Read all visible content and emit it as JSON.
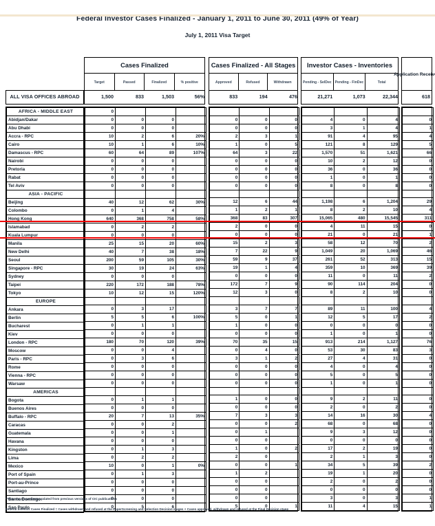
{
  "document": {
    "title": "Federal Investor Cases Finalized - January 1, 2011 to June 30, 2011 (49% of Year)",
    "subtitle": "July 1, 2011 Visa Target",
    "footnote_1": "**Data may have been updated from previous versions of CIC publications",
    "footnote_2": "Federal Investor Cases Finalized = Cases withdrawn and refused at the PaperScreening and Selection Decision stages + Cases approved, withdrawn and refused at the Final Decision stage",
    "highlight_color": "#ee0000"
  },
  "column_groups": [
    {
      "name": "cases-finalized",
      "label": "Cases Finalized",
      "columns": [
        "Target",
        "Passed",
        "Finalized",
        "% positive"
      ]
    },
    {
      "name": "cases-finalized-all-stages",
      "label": "Cases Finalized - All Stages",
      "columns": [
        "Approved",
        "Refused",
        "Withdrawn"
      ]
    },
    {
      "name": "investor-cases-inventories",
      "label": "Investor Cases - Inventories",
      "columns": [
        "Pending - SelDec",
        "Pending - FinDec",
        "Total"
      ]
    },
    {
      "name": "application-received",
      "label": "Application Received",
      "columns": []
    }
  ],
  "total_row": {
    "label": "ALL VISA OFFICES ABROAD",
    "target": "1,500",
    "passed": "833",
    "finalized": "1,503",
    "pct_positive": "56%",
    "approved": "833",
    "refused": "194",
    "withdrawn": "476",
    "pending_seldec": "21,271",
    "pending_findec": "1,073",
    "total": "22,344",
    "application_received": "618"
  },
  "rows": [
    {
      "type": "region",
      "label": "AFRICA - MIDDLE EAST",
      "target": "0",
      "passed": "",
      "finalized": "",
      "pct_positive": "",
      "approved": "",
      "refused": "",
      "withdrawn": "",
      "pending_seldec": "",
      "pending_findec": "",
      "total": "",
      "application_received": ""
    },
    {
      "type": "office",
      "label": "Abidjan/Dakar",
      "target": "0",
      "passed": "0",
      "finalized": "0",
      "pct_positive": "",
      "approved": "0",
      "refused": "0",
      "withdrawn": "0",
      "pending_seldec": "4",
      "pending_findec": "0",
      "total": "4",
      "application_received": "0"
    },
    {
      "type": "office",
      "label": "Abu Dhabi",
      "target": "0",
      "passed": "0",
      "finalized": "0",
      "pct_positive": "",
      "approved": "0",
      "refused": "0",
      "withdrawn": "0",
      "pending_seldec": "3",
      "pending_findec": "1",
      "total": "4",
      "application_received": "1"
    },
    {
      "type": "office",
      "label": "Accra - RPC",
      "target": "10",
      "passed": "2",
      "finalized": "6",
      "pct_positive": "20%",
      "approved": "2",
      "refused": "3",
      "withdrawn": "1",
      "pending_seldec": "91",
      "pending_findec": "4",
      "total": "95",
      "application_received": "4"
    },
    {
      "type": "office",
      "label": "Cairo",
      "target": "10",
      "passed": "1",
      "finalized": "6",
      "pct_positive": "10%",
      "approved": "1",
      "refused": "0",
      "withdrawn": "5",
      "pending_seldec": "121",
      "pending_findec": "8",
      "total": "129",
      "application_received": "5"
    },
    {
      "type": "office",
      "label": "Damascus - RPC",
      "target": "60",
      "passed": "64",
      "finalized": "89",
      "pct_positive": "107%",
      "approved": "64",
      "refused": "3",
      "withdrawn": "22",
      "pending_seldec": "1,570",
      "pending_findec": "51",
      "total": "1,621",
      "application_received": "66"
    },
    {
      "type": "office",
      "label": "Nairobi",
      "target": "0",
      "passed": "0",
      "finalized": "0",
      "pct_positive": "",
      "approved": "0",
      "refused": "0",
      "withdrawn": "0",
      "pending_seldec": "10",
      "pending_findec": "2",
      "total": "12",
      "application_received": "0"
    },
    {
      "type": "office",
      "label": "Pretoria",
      "target": "0",
      "passed": "0",
      "finalized": "0",
      "pct_positive": "",
      "approved": "0",
      "refused": "0",
      "withdrawn": "0",
      "pending_seldec": "36",
      "pending_findec": "0",
      "total": "36",
      "application_received": "0"
    },
    {
      "type": "office",
      "label": "Rabat",
      "target": "0",
      "passed": "0",
      "finalized": "0",
      "pct_positive": "",
      "approved": "0",
      "refused": "0",
      "withdrawn": "0",
      "pending_seldec": "1",
      "pending_findec": "0",
      "total": "1",
      "application_received": "0"
    },
    {
      "type": "office",
      "label": "Tel Aviv",
      "target": "0",
      "passed": "0",
      "finalized": "0",
      "pct_positive": "",
      "approved": "0",
      "refused": "0",
      "withdrawn": "0",
      "pending_seldec": "8",
      "pending_findec": "0",
      "total": "8",
      "application_received": "0"
    },
    {
      "type": "region",
      "label": "ASIA - PACIFIC",
      "target": "",
      "passed": "",
      "finalized": "",
      "pct_positive": "",
      "approved": "",
      "refused": "",
      "withdrawn": "",
      "pending_seldec": "",
      "pending_findec": "",
      "total": "",
      "application_received": ""
    },
    {
      "type": "office",
      "label": "Beijing",
      "target": "40",
      "passed": "12",
      "finalized": "62",
      "pct_positive": "30%",
      "approved": "12",
      "refused": "6",
      "withdrawn": "44",
      "pending_seldec": "1,198",
      "pending_findec": "6",
      "total": "1,204",
      "application_received": "29"
    },
    {
      "type": "office",
      "label": "Colombo",
      "target": "0",
      "passed": "1",
      "finalized": "4",
      "pct_positive": "",
      "approved": "1",
      "refused": "2",
      "withdrawn": "1",
      "pending_seldec": "8",
      "pending_findec": "2",
      "total": "10",
      "application_received": "4",
      "highlight": true
    },
    {
      "type": "office",
      "label": "Hong Kong",
      "target": "640",
      "passed": "368",
      "finalized": "758",
      "pct_positive": "58%",
      "approved": "368",
      "refused": "83",
      "withdrawn": "307",
      "pending_seldec": "15,065",
      "pending_findec": "480",
      "total": "15,545",
      "application_received": "311",
      "highlight": true
    },
    {
      "type": "office",
      "label": "Islamabad",
      "target": "0",
      "passed": "2",
      "finalized": "2",
      "pct_positive": "",
      "approved": "2",
      "refused": "0",
      "withdrawn": "0",
      "pending_seldec": "4",
      "pending_findec": "11",
      "total": "15",
      "application_received": "0"
    },
    {
      "type": "office",
      "label": "Kuala Lumpur",
      "target": "0",
      "passed": "0",
      "finalized": "0",
      "pct_positive": "",
      "approved": "0",
      "refused": "0",
      "withdrawn": "0",
      "pending_seldec": "21",
      "pending_findec": "0",
      "total": "21",
      "application_received": "1"
    },
    {
      "type": "office",
      "label": "Manila",
      "target": "25",
      "passed": "15",
      "finalized": "20",
      "pct_positive": "60%",
      "approved": "15",
      "refused": "2",
      "withdrawn": "3",
      "pending_seldec": "58",
      "pending_findec": "12",
      "total": "70",
      "application_received": "2"
    },
    {
      "type": "office",
      "label": "New Delhi",
      "target": "40",
      "passed": "7",
      "finalized": "38",
      "pct_positive": "18%",
      "approved": "7",
      "refused": "22",
      "withdrawn": "9",
      "pending_seldec": "1,049",
      "pending_findec": "20",
      "total": "1,069",
      "application_received": "46"
    },
    {
      "type": "office",
      "label": "Seoul",
      "target": "200",
      "passed": "59",
      "finalized": "105",
      "pct_positive": "30%",
      "approved": "59",
      "refused": "9",
      "withdrawn": "37",
      "pending_seldec": "261",
      "pending_findec": "52",
      "total": "313",
      "application_received": "15"
    },
    {
      "type": "office",
      "label": "Singapore - RPC",
      "target": "30",
      "passed": "19",
      "finalized": "24",
      "pct_positive": "63%",
      "approved": "19",
      "refused": "1",
      "withdrawn": "4",
      "pending_seldec": "359",
      "pending_findec": "10",
      "total": "369",
      "application_received": "39"
    },
    {
      "type": "office",
      "label": "Sydney",
      "target": "0",
      "passed": "0",
      "finalized": "0",
      "pct_positive": "",
      "approved": "0",
      "refused": "0",
      "withdrawn": "0",
      "pending_seldec": "11",
      "pending_findec": "0",
      "total": "11",
      "application_received": "2"
    },
    {
      "type": "office",
      "label": "Taipei",
      "target": "220",
      "passed": "172",
      "finalized": "188",
      "pct_positive": "78%",
      "approved": "172",
      "refused": "7",
      "withdrawn": "9",
      "pending_seldec": "90",
      "pending_findec": "114",
      "total": "204",
      "application_received": "0"
    },
    {
      "type": "office",
      "label": "Tokyo",
      "target": "10",
      "passed": "12",
      "finalized": "15",
      "pct_positive": "120%",
      "approved": "12",
      "refused": "3",
      "withdrawn": "0",
      "pending_seldec": "8",
      "pending_findec": "2",
      "total": "10",
      "application_received": "0"
    },
    {
      "type": "region",
      "label": "EUROPE",
      "target": "",
      "passed": "",
      "finalized": "",
      "pct_positive": "",
      "approved": "",
      "refused": "",
      "withdrawn": "",
      "pending_seldec": "",
      "pending_findec": "",
      "total": "",
      "application_received": ""
    },
    {
      "type": "office",
      "label": "Ankara",
      "target": "0",
      "passed": "3",
      "finalized": "17",
      "pct_positive": "",
      "approved": "3",
      "refused": "7",
      "withdrawn": "7",
      "pending_seldec": "89",
      "pending_findec": "11",
      "total": "100",
      "application_received": "4"
    },
    {
      "type": "office",
      "label": "Berlin",
      "target": "5",
      "passed": "5",
      "finalized": "6",
      "pct_positive": "100%",
      "approved": "5",
      "refused": "0",
      "withdrawn": "1",
      "pending_seldec": "12",
      "pending_findec": "5",
      "total": "17",
      "application_received": "2"
    },
    {
      "type": "office",
      "label": "Bucharest",
      "target": "0",
      "passed": "1",
      "finalized": "1",
      "pct_positive": "",
      "approved": "1",
      "refused": "0",
      "withdrawn": "0",
      "pending_seldec": "0",
      "pending_findec": "0",
      "total": "0",
      "application_received": "0"
    },
    {
      "type": "office",
      "label": "Kiev",
      "target": "0",
      "passed": "0",
      "finalized": "0",
      "pct_positive": "",
      "approved": "0",
      "refused": "0",
      "withdrawn": "0",
      "pending_seldec": "1",
      "pending_findec": "0",
      "total": "1",
      "application_received": "0"
    },
    {
      "type": "office",
      "label": "London - RPC",
      "target": "180",
      "passed": "70",
      "finalized": "120",
      "pct_positive": "39%",
      "approved": "70",
      "refused": "35",
      "withdrawn": "15",
      "pending_seldec": "913",
      "pending_findec": "214",
      "total": "1,127",
      "application_received": "76"
    },
    {
      "type": "office",
      "label": "Moscow",
      "target": "0",
      "passed": "0",
      "finalized": "4",
      "pct_positive": "",
      "approved": "0",
      "refused": "4",
      "withdrawn": "0",
      "pending_seldec": "53",
      "pending_findec": "30",
      "total": "83",
      "application_received": "3"
    },
    {
      "type": "office",
      "label": "Paris - RPC",
      "target": "0",
      "passed": "3",
      "finalized": "6",
      "pct_positive": "",
      "approved": "3",
      "refused": "1",
      "withdrawn": "2",
      "pending_seldec": "27",
      "pending_findec": "4",
      "total": "31",
      "application_received": "0"
    },
    {
      "type": "office",
      "label": "Rome",
      "target": "0",
      "passed": "0",
      "finalized": "0",
      "pct_positive": "",
      "approved": "0",
      "refused": "0",
      "withdrawn": "0",
      "pending_seldec": "4",
      "pending_findec": "0",
      "total": "4",
      "application_received": "0"
    },
    {
      "type": "office",
      "label": "Vienna - RPC",
      "target": "0",
      "passed": "0",
      "finalized": "0",
      "pct_positive": "",
      "approved": "0",
      "refused": "0",
      "withdrawn": "0",
      "pending_seldec": "5",
      "pending_findec": "0",
      "total": "5",
      "application_received": "0"
    },
    {
      "type": "office",
      "label": "Warsaw",
      "target": "0",
      "passed": "0",
      "finalized": "0",
      "pct_positive": "",
      "approved": "0",
      "refused": "0",
      "withdrawn": "0",
      "pending_seldec": "1",
      "pending_findec": "0",
      "total": "1",
      "application_received": "0"
    },
    {
      "type": "region",
      "label": "AMERICAS",
      "target": "",
      "passed": "",
      "finalized": "",
      "pct_positive": "",
      "approved": "",
      "refused": "",
      "withdrawn": "",
      "pending_seldec": "",
      "pending_findec": "",
      "total": "",
      "application_received": ""
    },
    {
      "type": "office",
      "label": "Bogota",
      "target": "0",
      "passed": "1",
      "finalized": "1",
      "pct_positive": "",
      "approved": "1",
      "refused": "0",
      "withdrawn": "0",
      "pending_seldec": "9",
      "pending_findec": "2",
      "total": "11",
      "application_received": "0"
    },
    {
      "type": "office",
      "label": "Buenos Aires",
      "target": "0",
      "passed": "0",
      "finalized": "0",
      "pct_positive": "",
      "approved": "0",
      "refused": "0",
      "withdrawn": "0",
      "pending_seldec": "2",
      "pending_findec": "0",
      "total": "2",
      "application_received": "0"
    },
    {
      "type": "office",
      "label": "Buffalo - RPC",
      "target": "20",
      "passed": "7",
      "finalized": "13",
      "pct_positive": "35%",
      "approved": "7",
      "refused": "3",
      "withdrawn": "3",
      "pending_seldec": "14",
      "pending_findec": "16",
      "total": "30",
      "application_received": "4"
    },
    {
      "type": "office",
      "label": "Caracas",
      "target": "0",
      "passed": "0",
      "finalized": "2",
      "pct_positive": "",
      "approved": "0",
      "refused": "0",
      "withdrawn": "2",
      "pending_seldec": "68",
      "pending_findec": "0",
      "total": "68",
      "application_received": "0"
    },
    {
      "type": "office",
      "label": "Guatemala",
      "target": "0",
      "passed": "0",
      "finalized": "1",
      "pct_positive": "",
      "approved": "0",
      "refused": "1",
      "withdrawn": "",
      "pending_seldec": "9",
      "pending_findec": "3",
      "total": "12",
      "application_received": "0"
    },
    {
      "type": "office",
      "label": "Havana",
      "target": "0",
      "passed": "0",
      "finalized": "0",
      "pct_positive": "",
      "approved": "0",
      "refused": "0",
      "withdrawn": "",
      "pending_seldec": "0",
      "pending_findec": "0",
      "total": "0",
      "application_received": "0"
    },
    {
      "type": "office",
      "label": "Kingston",
      "target": "0",
      "passed": "1",
      "finalized": "3",
      "pct_positive": "",
      "approved": "1",
      "refused": "0",
      "withdrawn": "2",
      "pending_seldec": "17",
      "pending_findec": "2",
      "total": "19",
      "application_received": "0"
    },
    {
      "type": "office",
      "label": "Lima",
      "target": "0",
      "passed": "2",
      "finalized": "2",
      "pct_positive": "",
      "approved": "2",
      "refused": "0",
      "withdrawn": "",
      "pending_seldec": "2",
      "pending_findec": "1",
      "total": "3",
      "application_received": "0"
    },
    {
      "type": "office",
      "label": "Mexico",
      "target": "10",
      "passed": "0",
      "finalized": "1",
      "pct_positive": "0%",
      "approved": "0",
      "refused": "0",
      "withdrawn": "1",
      "pending_seldec": "34",
      "pending_findec": "5",
      "total": "39",
      "application_received": "2"
    },
    {
      "type": "office",
      "label": "Port of Spain",
      "target": "0",
      "passed": "1",
      "finalized": "3",
      "pct_positive": "",
      "approved": "1",
      "refused": "2",
      "withdrawn": "",
      "pending_seldec": "19",
      "pending_findec": "1",
      "total": "20",
      "application_received": "0"
    },
    {
      "type": "office",
      "label": "Port-au-Prince",
      "target": "0",
      "passed": "0",
      "finalized": "0",
      "pct_positive": "",
      "approved": "0",
      "refused": "0",
      "withdrawn": "",
      "pending_seldec": "2",
      "pending_findec": "0",
      "total": "2",
      "application_received": "0"
    },
    {
      "type": "office",
      "label": "Santiago",
      "target": "0",
      "passed": "0",
      "finalized": "0",
      "pct_positive": "",
      "approved": "0",
      "refused": "0",
      "withdrawn": "",
      "pending_seldec": "0",
      "pending_findec": "0",
      "total": "0",
      "application_received": "0"
    },
    {
      "type": "office",
      "label": "Santo Domingo",
      "target": "0",
      "passed": "0",
      "finalized": "0",
      "pct_positive": "",
      "approved": "0",
      "refused": "0",
      "withdrawn": "",
      "pending_seldec": "3",
      "pending_findec": "0",
      "total": "3",
      "application_received": "1"
    },
    {
      "type": "office",
      "label": "Sao Paulo",
      "target": "0",
      "passed": "5",
      "finalized": "6",
      "pct_positive": "",
      "approved": "5",
      "refused": "0",
      "withdrawn": "1",
      "pending_seldec": "11",
      "pending_findec": "4",
      "total": "15",
      "application_received": "1"
    }
  ]
}
